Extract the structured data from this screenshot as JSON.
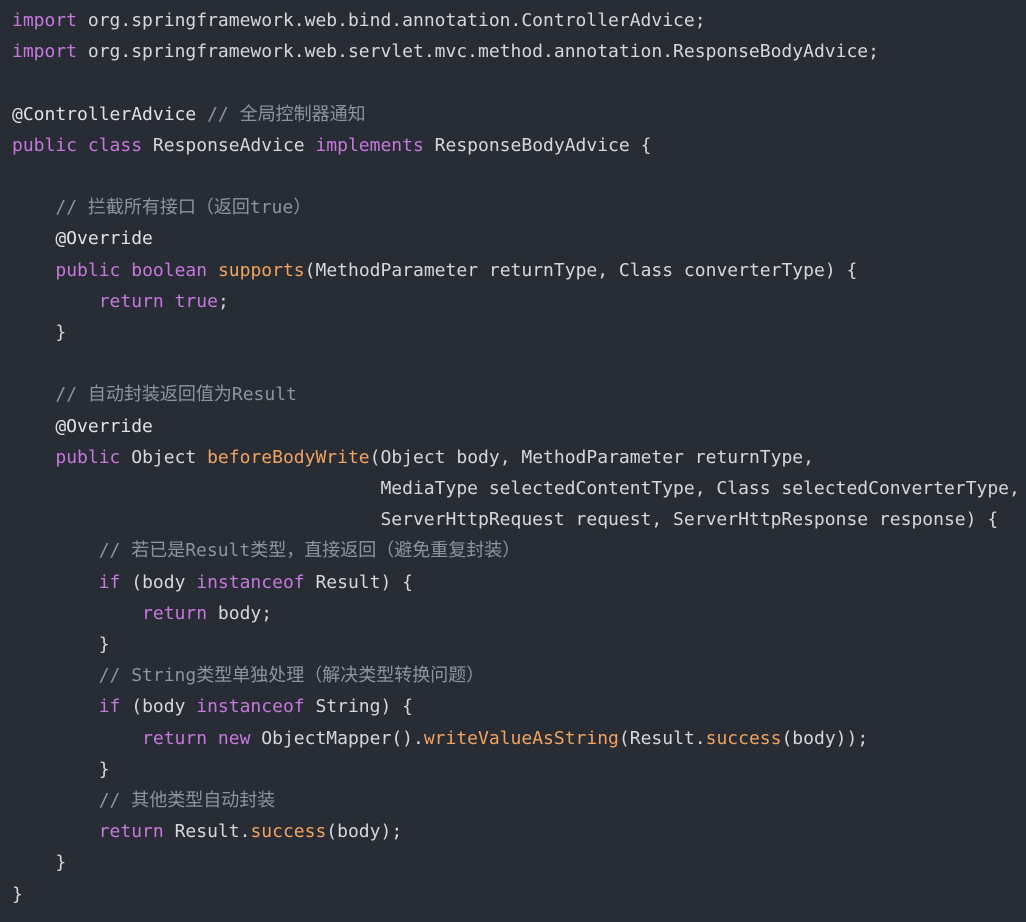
{
  "theme": {
    "background": "#282c34",
    "text": "#d4d8de",
    "keyword": "#c678dd",
    "function": "#f2a35e",
    "comment": "#8e949e"
  },
  "lines": [
    [
      {
        "t": "import",
        "c": "kw"
      },
      {
        "t": " org.springframework.web.bind.annotation.ControllerAdvice;",
        "c": "pl"
      }
    ],
    [
      {
        "t": "import",
        "c": "kw"
      },
      {
        "t": " org.springframework.web.servlet.mvc.method.annotation.ResponseBodyAdvice;",
        "c": "pl"
      }
    ],
    [],
    [
      {
        "t": "@ControllerAdvice",
        "c": "an"
      },
      {
        "t": " ",
        "c": "pl"
      },
      {
        "t": "// 全局控制器通知",
        "c": "cm"
      }
    ],
    [
      {
        "t": "public",
        "c": "kw"
      },
      {
        "t": " ",
        "c": "pl"
      },
      {
        "t": "class",
        "c": "kw"
      },
      {
        "t": " ResponseAdvice ",
        "c": "pl"
      },
      {
        "t": "implements",
        "c": "kw"
      },
      {
        "t": " ResponseBodyAdvice {",
        "c": "pl"
      }
    ],
    [],
    [
      {
        "t": "    ",
        "c": "pl"
      },
      {
        "t": "// 拦截所有接口（返回true）",
        "c": "cm"
      }
    ],
    [
      {
        "t": "    @Override",
        "c": "an"
      }
    ],
    [
      {
        "t": "    ",
        "c": "pl"
      },
      {
        "t": "public",
        "c": "kw"
      },
      {
        "t": " ",
        "c": "pl"
      },
      {
        "t": "boolean",
        "c": "kw"
      },
      {
        "t": " ",
        "c": "pl"
      },
      {
        "t": "supports",
        "c": "fn"
      },
      {
        "t": "(MethodParameter returnType, Class converterType) {",
        "c": "pl"
      }
    ],
    [
      {
        "t": "        ",
        "c": "pl"
      },
      {
        "t": "return",
        "c": "kw"
      },
      {
        "t": " ",
        "c": "pl"
      },
      {
        "t": "true",
        "c": "kw"
      },
      {
        "t": ";",
        "c": "pl"
      }
    ],
    [
      {
        "t": "    }",
        "c": "pl"
      }
    ],
    [],
    [
      {
        "t": "    ",
        "c": "pl"
      },
      {
        "t": "// 自动封装返回值为Result",
        "c": "cm"
      }
    ],
    [
      {
        "t": "    @Override",
        "c": "an"
      }
    ],
    [
      {
        "t": "    ",
        "c": "pl"
      },
      {
        "t": "public",
        "c": "kw"
      },
      {
        "t": " Object ",
        "c": "pl"
      },
      {
        "t": "beforeBodyWrite",
        "c": "fn"
      },
      {
        "t": "(Object body, MethodParameter returnType,",
        "c": "pl"
      }
    ],
    [
      {
        "t": "                                  MediaType selectedContentType, Class selectedConverterType,",
        "c": "pl"
      }
    ],
    [
      {
        "t": "                                  ServerHttpRequest request, ServerHttpResponse response) {",
        "c": "pl"
      }
    ],
    [
      {
        "t": "        ",
        "c": "pl"
      },
      {
        "t": "// 若已是Result类型，直接返回（避免重复封装）",
        "c": "cm"
      }
    ],
    [
      {
        "t": "        ",
        "c": "pl"
      },
      {
        "t": "if",
        "c": "kw"
      },
      {
        "t": " (body ",
        "c": "pl"
      },
      {
        "t": "instanceof",
        "c": "kw"
      },
      {
        "t": " Result) {",
        "c": "pl"
      }
    ],
    [
      {
        "t": "            ",
        "c": "pl"
      },
      {
        "t": "return",
        "c": "kw"
      },
      {
        "t": " body;",
        "c": "pl"
      }
    ],
    [
      {
        "t": "        }",
        "c": "pl"
      }
    ],
    [
      {
        "t": "        ",
        "c": "pl"
      },
      {
        "t": "// String类型单独处理（解决类型转换问题）",
        "c": "cm"
      }
    ],
    [
      {
        "t": "        ",
        "c": "pl"
      },
      {
        "t": "if",
        "c": "kw"
      },
      {
        "t": " (body ",
        "c": "pl"
      },
      {
        "t": "instanceof",
        "c": "kw"
      },
      {
        "t": " String) {",
        "c": "pl"
      }
    ],
    [
      {
        "t": "            ",
        "c": "pl"
      },
      {
        "t": "return",
        "c": "kw"
      },
      {
        "t": " ",
        "c": "pl"
      },
      {
        "t": "new",
        "c": "kw"
      },
      {
        "t": " ObjectMapper().",
        "c": "pl"
      },
      {
        "t": "writeValueAsString",
        "c": "fn"
      },
      {
        "t": "(Result.",
        "c": "pl"
      },
      {
        "t": "success",
        "c": "fn"
      },
      {
        "t": "(body));",
        "c": "pl"
      }
    ],
    [
      {
        "t": "        }",
        "c": "pl"
      }
    ],
    [
      {
        "t": "        ",
        "c": "pl"
      },
      {
        "t": "// 其他类型自动封装",
        "c": "cm"
      }
    ],
    [
      {
        "t": "        ",
        "c": "pl"
      },
      {
        "t": "return",
        "c": "kw"
      },
      {
        "t": " Result.",
        "c": "pl"
      },
      {
        "t": "success",
        "c": "fn"
      },
      {
        "t": "(body);",
        "c": "pl"
      }
    ],
    [
      {
        "t": "    }",
        "c": "pl"
      }
    ],
    [
      {
        "t": "}",
        "c": "pl"
      }
    ]
  ]
}
